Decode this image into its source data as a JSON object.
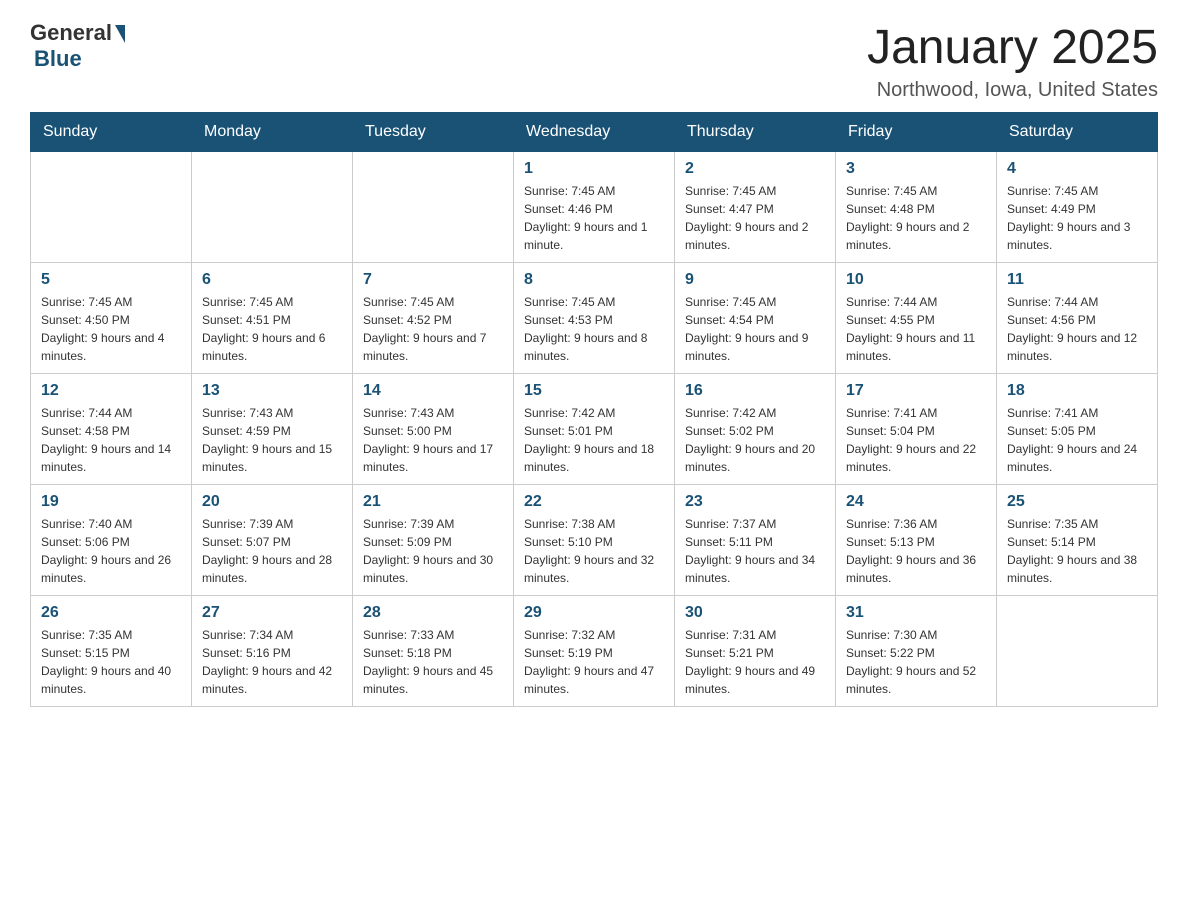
{
  "logo": {
    "general": "General",
    "blue": "Blue"
  },
  "header": {
    "title": "January 2025",
    "location": "Northwood, Iowa, United States"
  },
  "days_of_week": [
    "Sunday",
    "Monday",
    "Tuesday",
    "Wednesday",
    "Thursday",
    "Friday",
    "Saturday"
  ],
  "weeks": [
    [
      {
        "day": "",
        "info": ""
      },
      {
        "day": "",
        "info": ""
      },
      {
        "day": "",
        "info": ""
      },
      {
        "day": "1",
        "info": "Sunrise: 7:45 AM\nSunset: 4:46 PM\nDaylight: 9 hours and 1 minute."
      },
      {
        "day": "2",
        "info": "Sunrise: 7:45 AM\nSunset: 4:47 PM\nDaylight: 9 hours and 2 minutes."
      },
      {
        "day": "3",
        "info": "Sunrise: 7:45 AM\nSunset: 4:48 PM\nDaylight: 9 hours and 2 minutes."
      },
      {
        "day": "4",
        "info": "Sunrise: 7:45 AM\nSunset: 4:49 PM\nDaylight: 9 hours and 3 minutes."
      }
    ],
    [
      {
        "day": "5",
        "info": "Sunrise: 7:45 AM\nSunset: 4:50 PM\nDaylight: 9 hours and 4 minutes."
      },
      {
        "day": "6",
        "info": "Sunrise: 7:45 AM\nSunset: 4:51 PM\nDaylight: 9 hours and 6 minutes."
      },
      {
        "day": "7",
        "info": "Sunrise: 7:45 AM\nSunset: 4:52 PM\nDaylight: 9 hours and 7 minutes."
      },
      {
        "day": "8",
        "info": "Sunrise: 7:45 AM\nSunset: 4:53 PM\nDaylight: 9 hours and 8 minutes."
      },
      {
        "day": "9",
        "info": "Sunrise: 7:45 AM\nSunset: 4:54 PM\nDaylight: 9 hours and 9 minutes."
      },
      {
        "day": "10",
        "info": "Sunrise: 7:44 AM\nSunset: 4:55 PM\nDaylight: 9 hours and 11 minutes."
      },
      {
        "day": "11",
        "info": "Sunrise: 7:44 AM\nSunset: 4:56 PM\nDaylight: 9 hours and 12 minutes."
      }
    ],
    [
      {
        "day": "12",
        "info": "Sunrise: 7:44 AM\nSunset: 4:58 PM\nDaylight: 9 hours and 14 minutes."
      },
      {
        "day": "13",
        "info": "Sunrise: 7:43 AM\nSunset: 4:59 PM\nDaylight: 9 hours and 15 minutes."
      },
      {
        "day": "14",
        "info": "Sunrise: 7:43 AM\nSunset: 5:00 PM\nDaylight: 9 hours and 17 minutes."
      },
      {
        "day": "15",
        "info": "Sunrise: 7:42 AM\nSunset: 5:01 PM\nDaylight: 9 hours and 18 minutes."
      },
      {
        "day": "16",
        "info": "Sunrise: 7:42 AM\nSunset: 5:02 PM\nDaylight: 9 hours and 20 minutes."
      },
      {
        "day": "17",
        "info": "Sunrise: 7:41 AM\nSunset: 5:04 PM\nDaylight: 9 hours and 22 minutes."
      },
      {
        "day": "18",
        "info": "Sunrise: 7:41 AM\nSunset: 5:05 PM\nDaylight: 9 hours and 24 minutes."
      }
    ],
    [
      {
        "day": "19",
        "info": "Sunrise: 7:40 AM\nSunset: 5:06 PM\nDaylight: 9 hours and 26 minutes."
      },
      {
        "day": "20",
        "info": "Sunrise: 7:39 AM\nSunset: 5:07 PM\nDaylight: 9 hours and 28 minutes."
      },
      {
        "day": "21",
        "info": "Sunrise: 7:39 AM\nSunset: 5:09 PM\nDaylight: 9 hours and 30 minutes."
      },
      {
        "day": "22",
        "info": "Sunrise: 7:38 AM\nSunset: 5:10 PM\nDaylight: 9 hours and 32 minutes."
      },
      {
        "day": "23",
        "info": "Sunrise: 7:37 AM\nSunset: 5:11 PM\nDaylight: 9 hours and 34 minutes."
      },
      {
        "day": "24",
        "info": "Sunrise: 7:36 AM\nSunset: 5:13 PM\nDaylight: 9 hours and 36 minutes."
      },
      {
        "day": "25",
        "info": "Sunrise: 7:35 AM\nSunset: 5:14 PM\nDaylight: 9 hours and 38 minutes."
      }
    ],
    [
      {
        "day": "26",
        "info": "Sunrise: 7:35 AM\nSunset: 5:15 PM\nDaylight: 9 hours and 40 minutes."
      },
      {
        "day": "27",
        "info": "Sunrise: 7:34 AM\nSunset: 5:16 PM\nDaylight: 9 hours and 42 minutes."
      },
      {
        "day": "28",
        "info": "Sunrise: 7:33 AM\nSunset: 5:18 PM\nDaylight: 9 hours and 45 minutes."
      },
      {
        "day": "29",
        "info": "Sunrise: 7:32 AM\nSunset: 5:19 PM\nDaylight: 9 hours and 47 minutes."
      },
      {
        "day": "30",
        "info": "Sunrise: 7:31 AM\nSunset: 5:21 PM\nDaylight: 9 hours and 49 minutes."
      },
      {
        "day": "31",
        "info": "Sunrise: 7:30 AM\nSunset: 5:22 PM\nDaylight: 9 hours and 52 minutes."
      },
      {
        "day": "",
        "info": ""
      }
    ]
  ]
}
